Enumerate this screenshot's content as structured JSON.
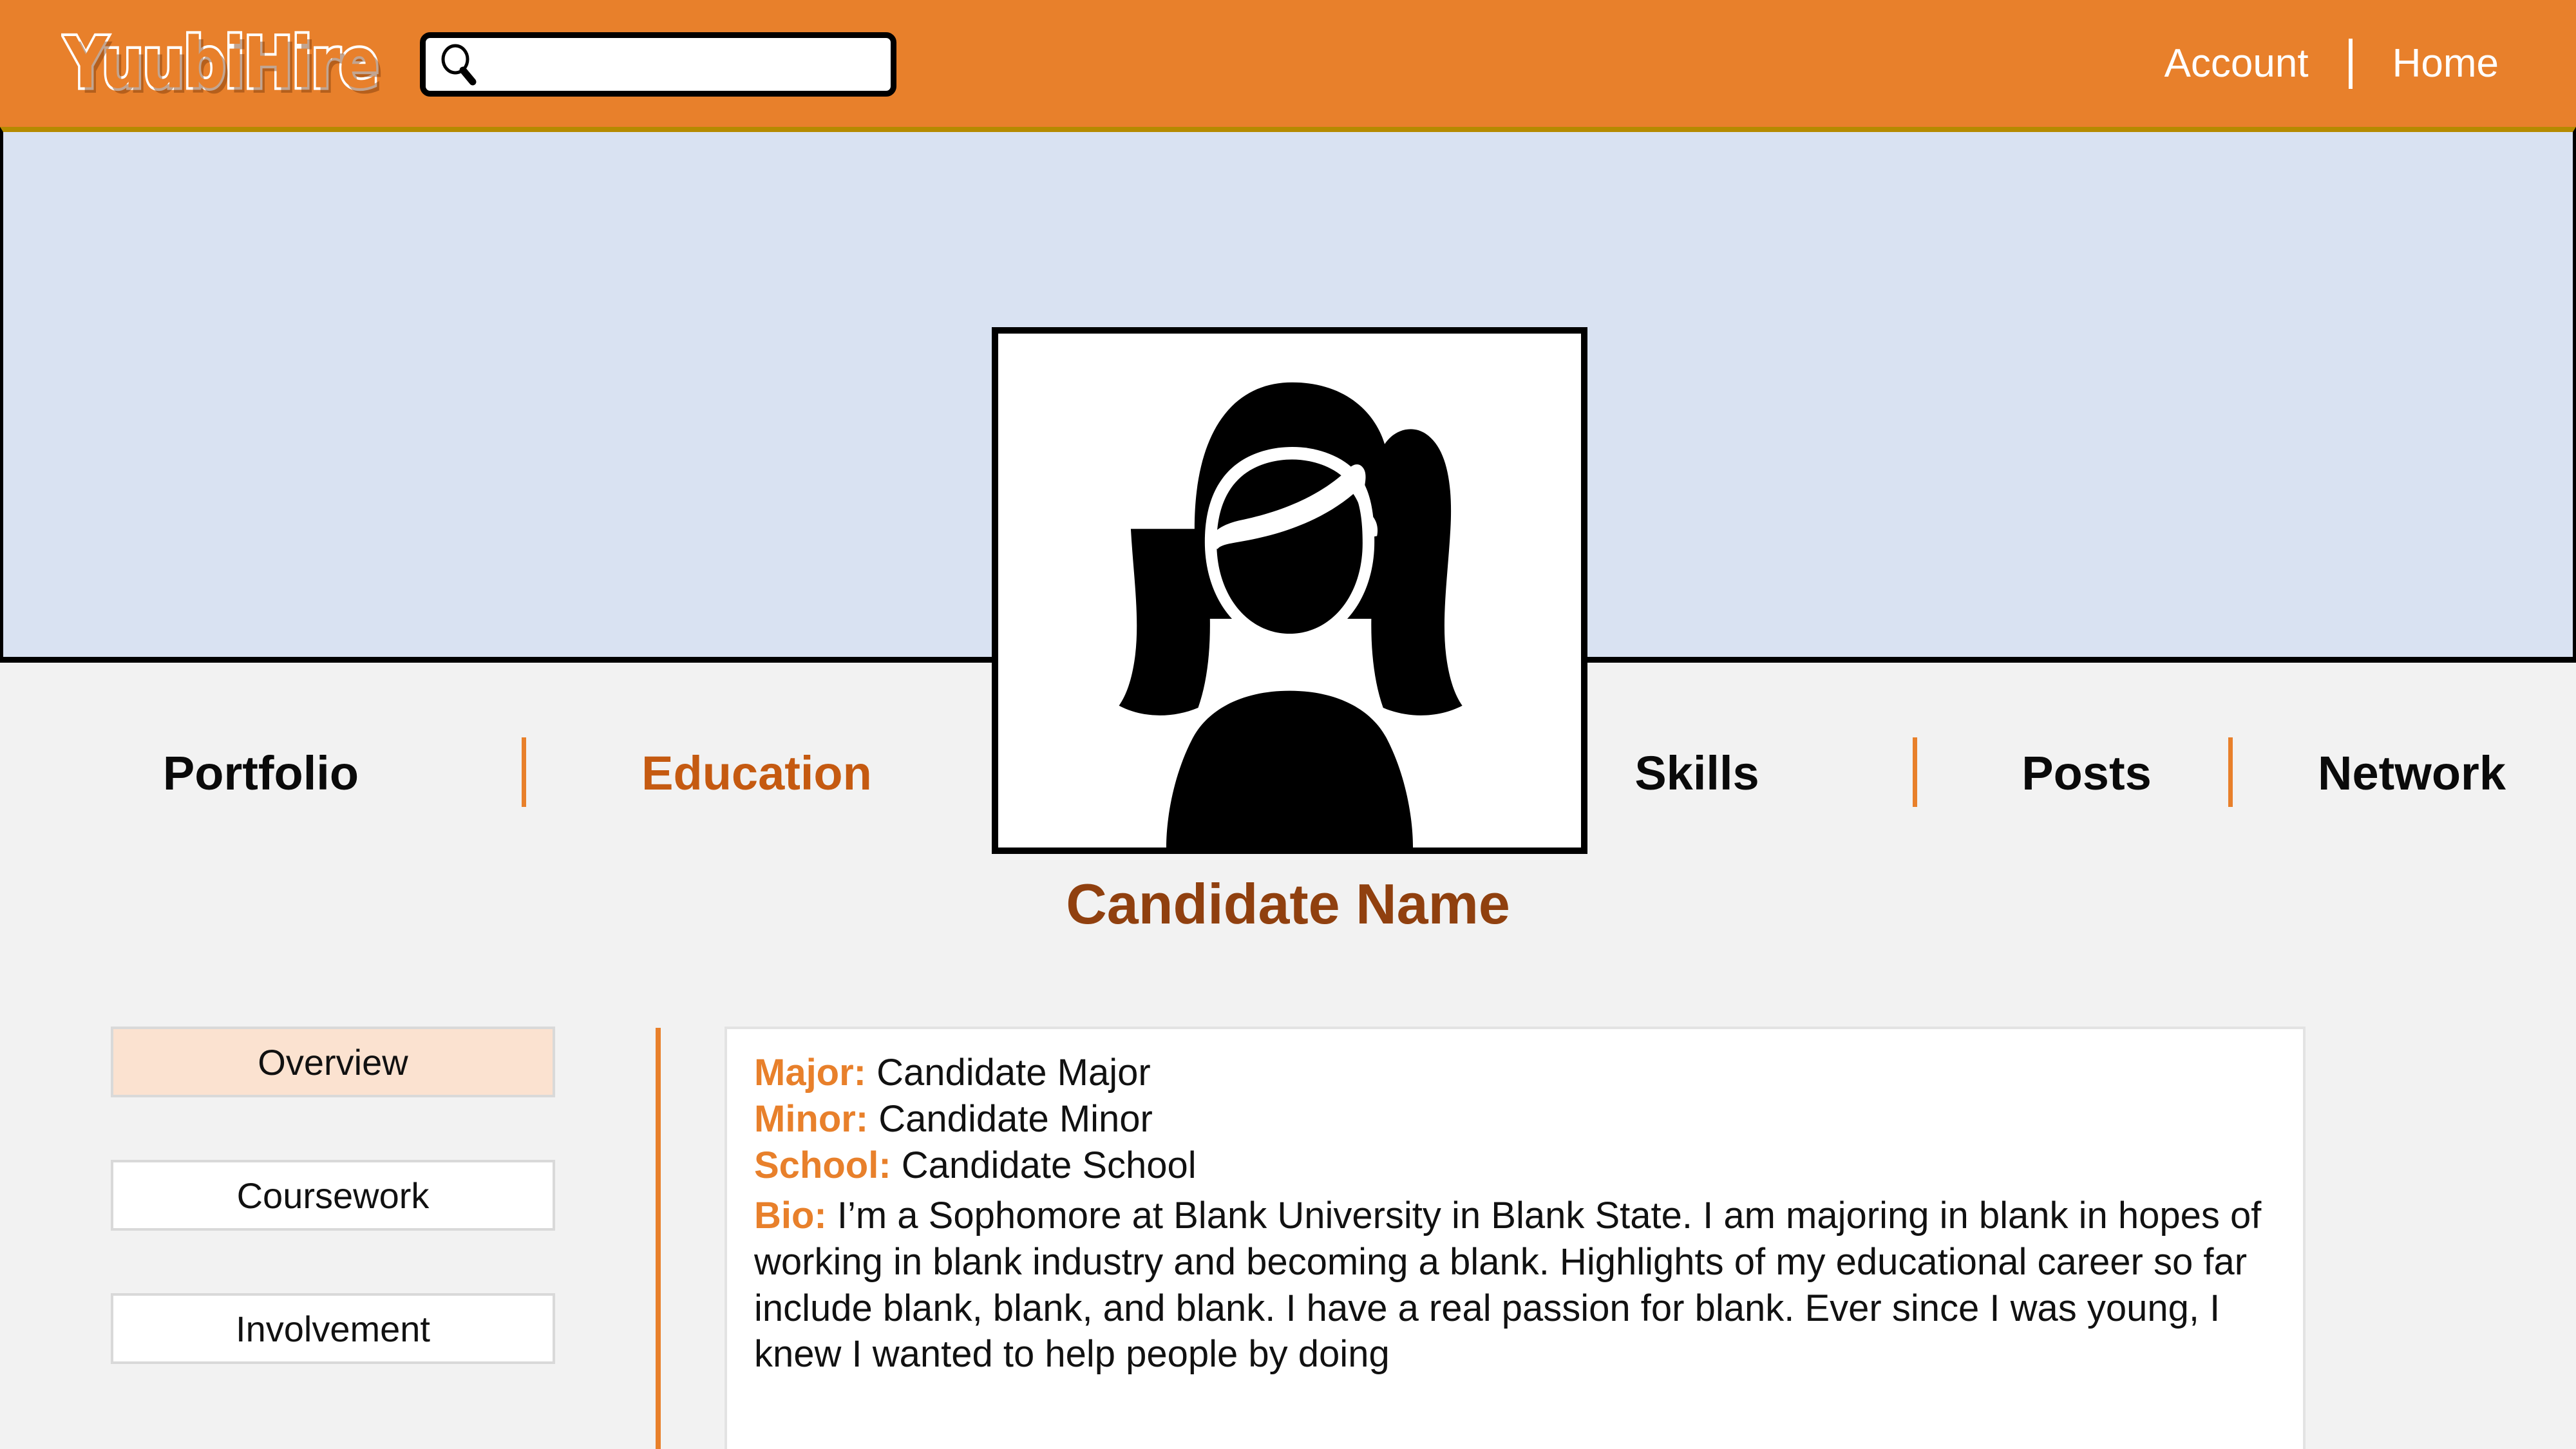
{
  "app": {
    "logo_text": "YuubiHire",
    "brand_orange": "#E8802B",
    "accent_dark_orange": "#C55A11",
    "name_brown": "#90400F",
    "banner_blue": "#d9e2f2",
    "page_bg": "#f2f2f2"
  },
  "search": {
    "value": "",
    "placeholder": "",
    "icon": "search-icon"
  },
  "topnav": {
    "account_label": "Account",
    "home_label": "Home"
  },
  "profile": {
    "avatar_icon": "person-avatar-icon",
    "candidate_name": "Candidate Name"
  },
  "tabs": [
    {
      "label": "Portfolio",
      "active": false
    },
    {
      "label": "Education",
      "active": true
    },
    {
      "label": "Skills",
      "active": false
    },
    {
      "label": "Posts",
      "active": false
    },
    {
      "label": "Network",
      "active": false
    }
  ],
  "sidebar": {
    "items": [
      {
        "label": "Overview",
        "active": true
      },
      {
        "label": "Coursework",
        "active": false
      },
      {
        "label": "Involvement",
        "active": false
      }
    ]
  },
  "education": {
    "major_label": "Major:",
    "major_value": " Candidate Major",
    "minor_label": "Minor:",
    "minor_value": " Candidate Minor",
    "school_label": "School:",
    "school_value": " Candidate School",
    "bio_label": "Bio:",
    "bio_value": " I’m a Sophomore at Blank University in Blank State. I am majoring in blank in hopes of working in blank industry and becoming a blank. Highlights of my educational career so far include blank, blank, and blank. I have a real passion for blank. Ever since I was young, I knew I wanted to help people by doing"
  }
}
